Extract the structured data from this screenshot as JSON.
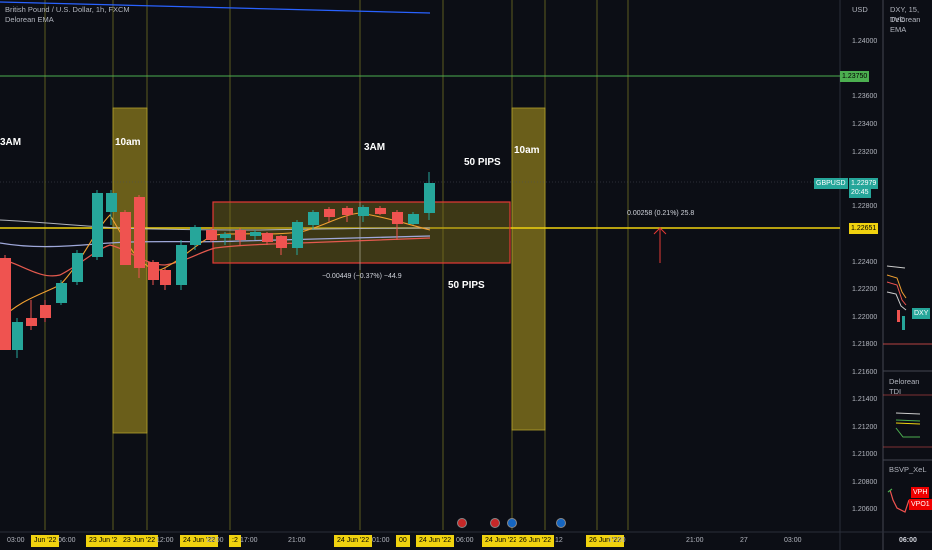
{
  "header": {
    "symbol_line": "British Pound / U.S. Dollar, 1h, FXCM",
    "indicator": "Delorean EMA"
  },
  "right_panel": {
    "symbol_line": "DXY, 15, TVC",
    "indicator": "Delorean EMA",
    "tdi_label": "Delorean TDI",
    "bsvp_label": "BSVP_XeL",
    "vph_badge": "VPH",
    "vpo_badge": "VPO1",
    "dxy_badge": "DXY",
    "time_label": "06:00"
  },
  "price_axis": {
    "currency": "USD",
    "ticks": [
      "1.24000",
      "1.23600",
      "1.23400",
      "1.23200",
      "1.22800",
      "1.22400",
      "1.22200",
      "1.22000",
      "1.21800",
      "1.21600",
      "1.21400",
      "1.21200",
      "1.21000",
      "1.20800",
      "1.20600"
    ],
    "green_level": "1.23750",
    "symbol_badge": "GBPUSD",
    "current_price": "1.22979",
    "countdown": "20:45",
    "yellow_level": "1.22651"
  },
  "annotations": {
    "label_3am_left": "3AM",
    "label_10am_left": "10am",
    "label_3am_mid": "3AM",
    "label_50pips_top": "50 PIPS",
    "label_10am_right": "10am",
    "label_50pips_bottom": "50 PIPS",
    "range_measure": "−0.00449 (−0.37%) −44.9",
    "up_measure": "0.00258 (0.21%) 25.8"
  },
  "time_axis": {
    "labels": [
      {
        "text": "03:00",
        "hl": false
      },
      {
        "text": "Jun '22",
        "hl": true
      },
      {
        "text": "06:00",
        "hl": false
      },
      {
        "text": "23 Jun '2",
        "hl": true
      },
      {
        "text": "23 Jun '22",
        "hl": true
      },
      {
        "text": "12:00",
        "hl": false
      },
      {
        "text": "24 Jun '22",
        "hl": true
      },
      {
        "text": "15:00",
        "hl": false
      },
      {
        "text": ":2",
        "hl": true
      },
      {
        "text": "17:00",
        "hl": false
      },
      {
        "text": "21:00",
        "hl": false
      },
      {
        "text": "24 Jun '22",
        "hl": true
      },
      {
        "text": "01:00",
        "hl": false
      },
      {
        "text": "00",
        "hl": true
      },
      {
        "text": "24 Jun '22",
        "hl": true
      },
      {
        "text": "06:00",
        "hl": false
      },
      {
        "text": "24 Jun '22",
        "hl": true
      },
      {
        "text": "26 Jun '22",
        "hl": true
      },
      {
        "text": "12",
        "hl": false
      },
      {
        "text": "26 Jun '22",
        "hl": true
      },
      {
        "text": "17:00",
        "hl": false
      },
      {
        "text": "21:00",
        "hl": false
      },
      {
        "text": "27",
        "hl": false
      },
      {
        "text": "03:00",
        "hl": false
      }
    ]
  },
  "colors": {
    "up": "#26a69a",
    "down": "#ef5350",
    "zone": "#8a7a1c",
    "yellow_line": "#f0d20f",
    "green_line": "#4caf50",
    "red_box": "#e53935"
  }
}
